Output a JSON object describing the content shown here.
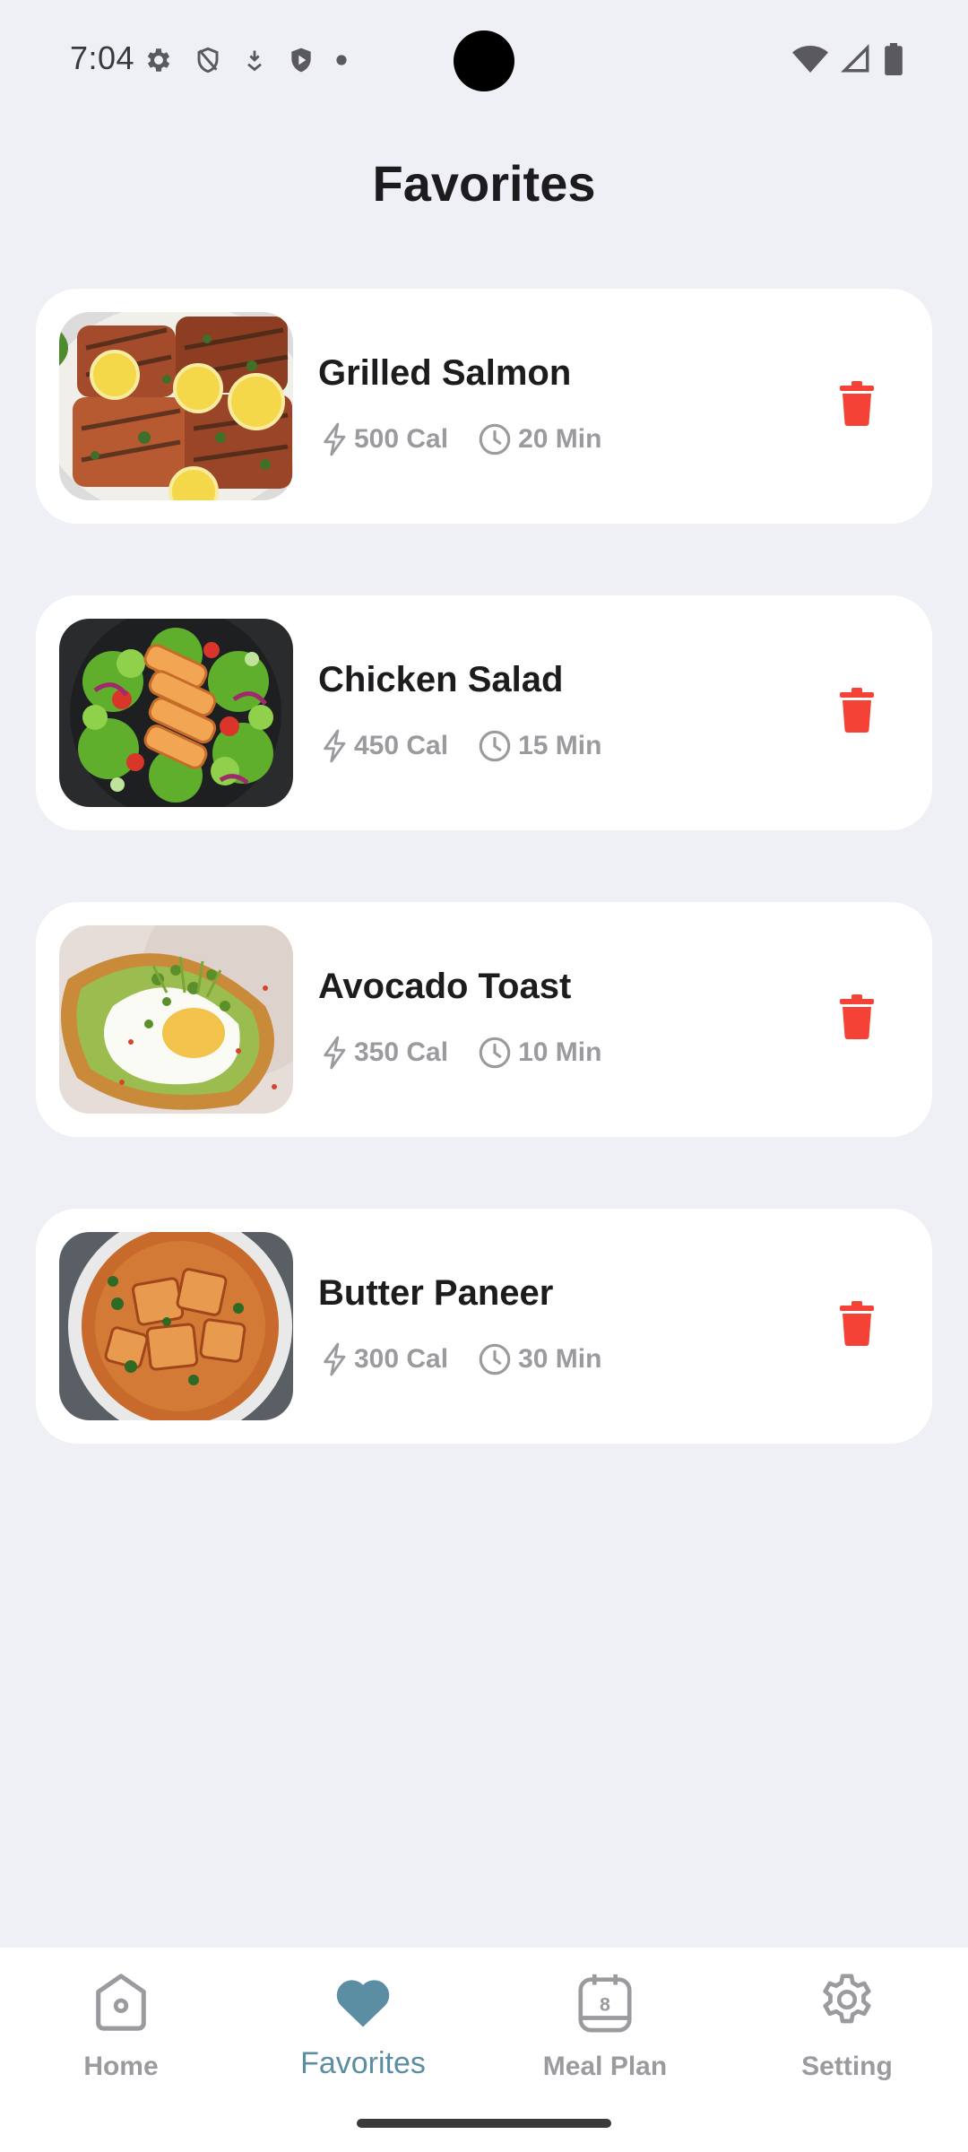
{
  "status_bar": {
    "time": "7:04",
    "left_icons": [
      "settings-icon",
      "shield-icon",
      "download-icon",
      "play-protect-icon",
      "dot-icon"
    ],
    "right_icons": [
      "wifi-icon",
      "signal-icon",
      "battery-icon"
    ]
  },
  "page": {
    "title": "Favorites"
  },
  "favorites": [
    {
      "name": "Grilled Salmon",
      "calories": "500 Cal",
      "time": "20 Min",
      "image": "grilled-salmon-image"
    },
    {
      "name": "Chicken Salad",
      "calories": "450 Cal",
      "time": "15 Min",
      "image": "chicken-salad-image"
    },
    {
      "name": "Avocado Toast",
      "calories": "350 Cal",
      "time": "10 Min",
      "image": "avocado-toast-image"
    },
    {
      "name": "Butter Paneer",
      "calories": "300 Cal",
      "time": "30 Min",
      "image": "butter-paneer-image"
    }
  ],
  "nav": {
    "items": [
      {
        "label": "Home",
        "icon": "home-icon"
      },
      {
        "label": "Favorites",
        "icon": "heart-icon",
        "active": true
      },
      {
        "label": "Meal Plan",
        "icon": "calendar-icon",
        "day": "8"
      },
      {
        "label": "Setting",
        "icon": "gear-icon"
      }
    ]
  },
  "colors": {
    "background": "#eff0f5",
    "card": "#ffffff",
    "delete": "#f44336",
    "accent": "#5b8ea3",
    "muted": "#9a9a9f"
  }
}
